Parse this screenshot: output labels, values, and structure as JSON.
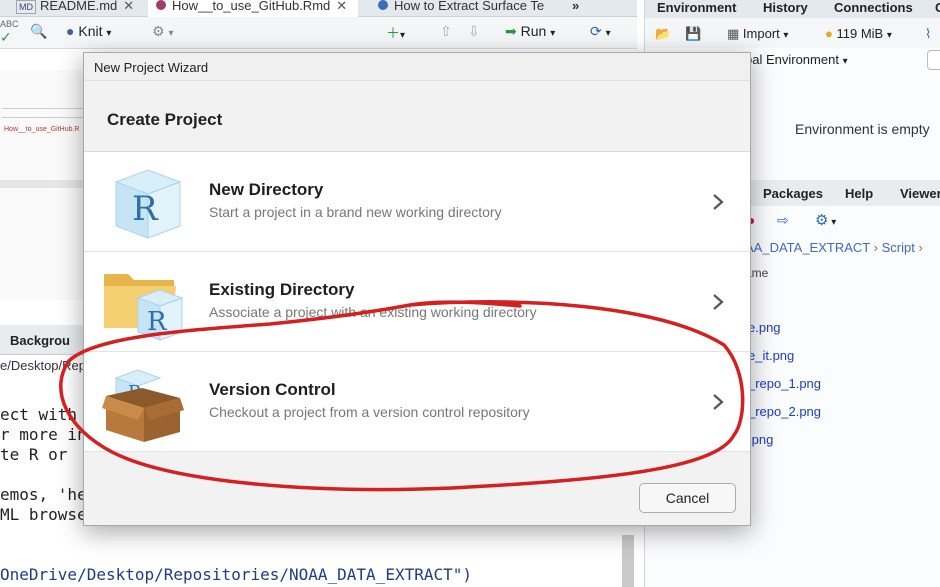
{
  "editor": {
    "tabs": [
      {
        "badge": "MD",
        "label": "README.md"
      },
      {
        "label": "How__to_use_GitHub.Rmd"
      },
      {
        "label": "How to Extract Surface Te"
      }
    ],
    "toolbar": {
      "spellcheck_label": "ABC",
      "knit_label": "Knit",
      "run_label": "Run"
    },
    "thumb_label": "How__to_use_GitHub.R"
  },
  "console": {
    "tab_label": "Backgrou",
    "path": "e/Desktop/Rep",
    "lines": [
      "ect with",
      "r more in",
      "te R or",
      "emos, 'he",
      "ML browse"
    ],
    "command": "OneDrive/Desktop/Repositories/NOAA_DATA_EXTRACT\")"
  },
  "right_pane": {
    "tabs": [
      "Environment",
      "History",
      "Connections",
      "G"
    ],
    "import_label": "Import",
    "memory_label": "119 MiB",
    "env_scope": "bal Environment",
    "env_empty": "Environment is empty",
    "files_tabs": [
      "Packages",
      "Help",
      "Viewer"
    ],
    "breadcrumb": {
      "folder": "AA_DATA_EXTRACT",
      "sub": "Script"
    },
    "name_column": "ame",
    "files": [
      "e.png",
      "e_it.png",
      "_repo_1.png",
      "_repo_2.png",
      ".png"
    ]
  },
  "dialog": {
    "title": "New Project Wizard",
    "heading": "Create Project",
    "options": [
      {
        "icon": "r-cube-icon",
        "title": "New Directory",
        "description": "Start a project in a brand new working directory"
      },
      {
        "icon": "folder-r-cube-icon",
        "title": "Existing Directory",
        "description": "Associate a project with an existing working directory"
      },
      {
        "icon": "box-r-cube-icon",
        "title": "Version Control",
        "description": "Checkout a project from a version control repository"
      }
    ],
    "cancel_label": "Cancel"
  },
  "annotation": {
    "color": "#d42020",
    "shape": "hand-drawn ellipse around Version Control option"
  }
}
